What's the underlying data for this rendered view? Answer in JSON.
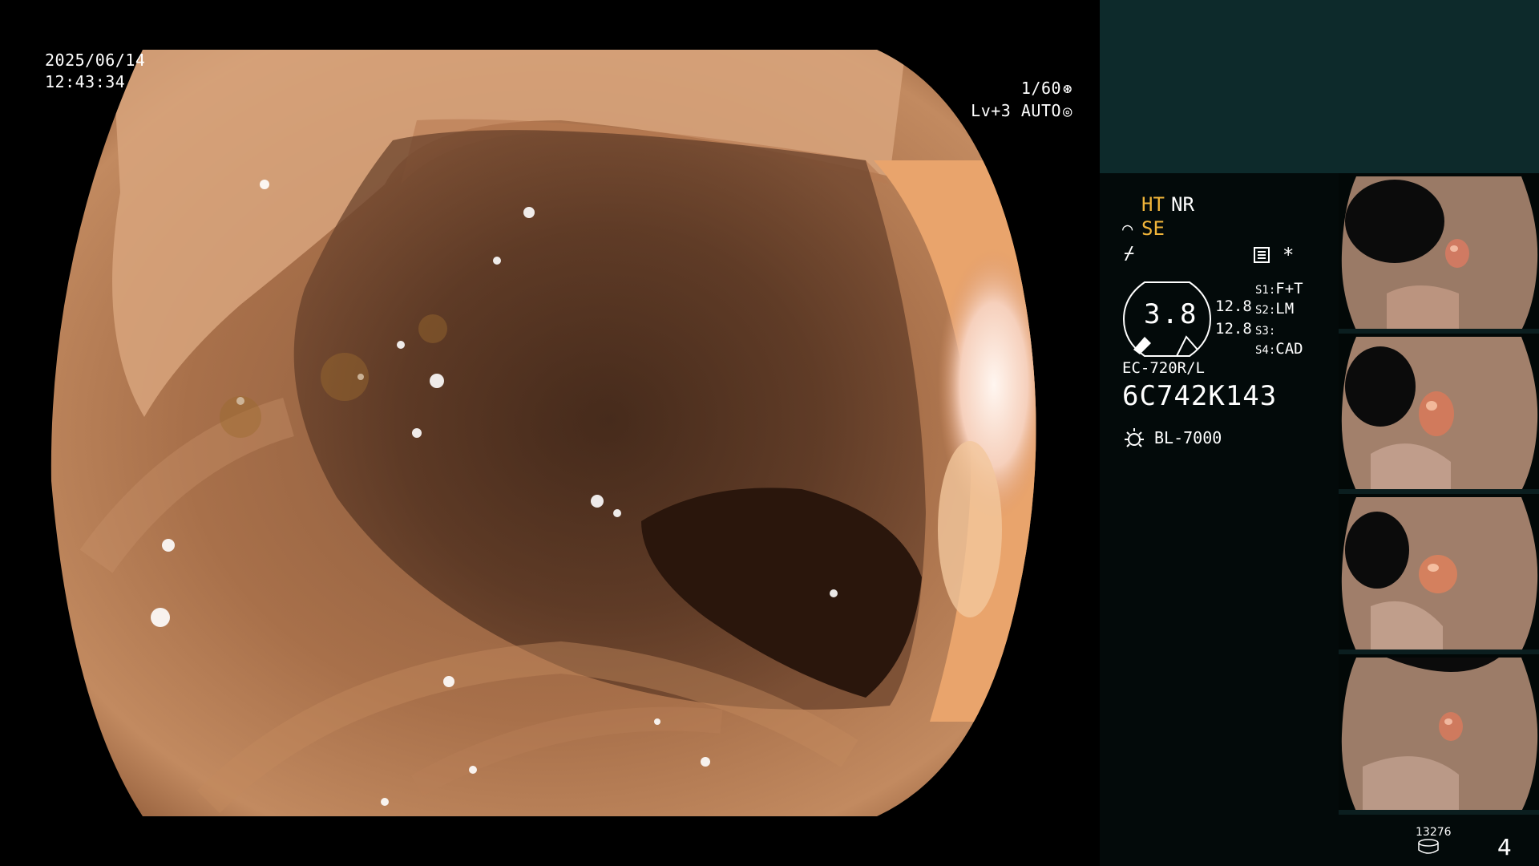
{
  "osd": {
    "date": "2025/06/14",
    "time": "12:43:34",
    "shutter": "1/60",
    "shutter_icon": "aperture-icon",
    "level": "Lv+3",
    "auto": "AUTO",
    "auto_icon": "iris-icon"
  },
  "panel": {
    "ht": "HT",
    "nr": "NR",
    "se": "SE",
    "se_icon": "scope-icon",
    "bolt_icon": "bolt-icon",
    "menu_icon": "menu-icon",
    "star": "*",
    "gauge_value": "3.8",
    "gauge_top": "12.8",
    "gauge_bottom": "12.8",
    "switches": [
      {
        "label": "S1:",
        "value": "F+T"
      },
      {
        "label": "S2:",
        "value": "LM"
      },
      {
        "label": "S3:",
        "value": ""
      },
      {
        "label": "S4:",
        "value": "CAD"
      }
    ],
    "model": "EC-720R/L",
    "serial": "6C742K143",
    "light_icon": "sun-icon",
    "light_source": "BL-7000",
    "image_count": "13276",
    "counter_icon": "storage-icon",
    "page": "4"
  },
  "colors": {
    "accent": "#f1b53a",
    "panel_top": "#0d2a2b",
    "panel_bg": "#030a0a",
    "mucosa": "#a8704a",
    "lumen": "#3a2216"
  }
}
